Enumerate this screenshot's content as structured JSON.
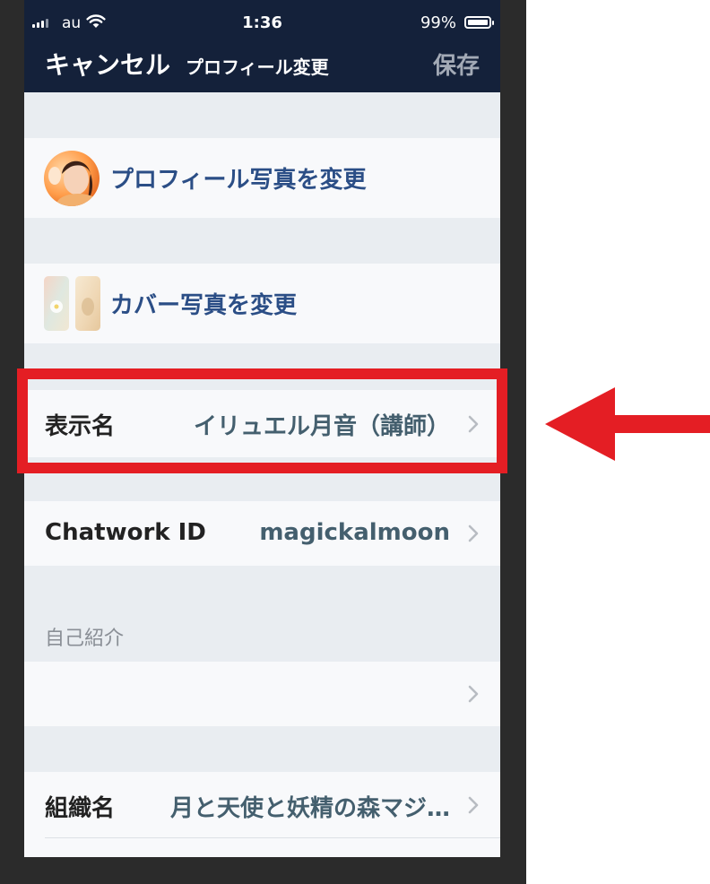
{
  "status_bar": {
    "carrier": "au",
    "time": "1:36",
    "battery": "99%"
  },
  "nav": {
    "cancel_label": "キャンセル",
    "title": "プロフィール変更",
    "save_label": "保存"
  },
  "profile_photo": {
    "label": "プロフィール写真を変更"
  },
  "cover_photo": {
    "label": "カバー写真を変更"
  },
  "display_name": {
    "label": "表示名",
    "value": "イリュエル月音（講師）"
  },
  "chatwork_id": {
    "label": "Chatwork ID",
    "value": "magickalmoon"
  },
  "self_intro": {
    "header": "自己紹介",
    "value": ""
  },
  "organization": {
    "label": "組織名",
    "value": "月と天使と妖精の森マジ…"
  },
  "colors": {
    "nav_bg": "#14213a",
    "link": "#2b4e86",
    "highlight": "#e41e24"
  }
}
